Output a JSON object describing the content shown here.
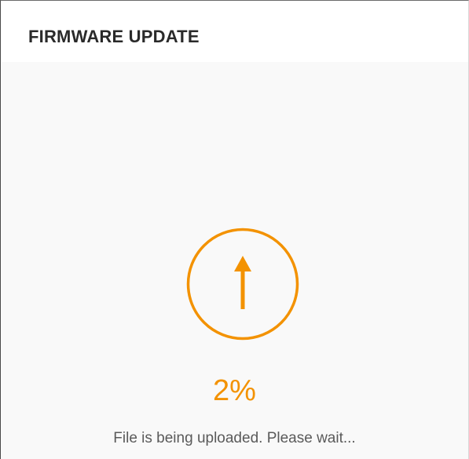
{
  "dialog": {
    "title": "FIRMWARE UPDATE"
  },
  "upload": {
    "icon": "upload-arrow-icon",
    "progress_text": "2%",
    "progress_fraction": 0.02,
    "status_text": "File is being uploaded. Please wait..."
  },
  "colors": {
    "accent": "#f39200",
    "title": "#2a2a2a",
    "status": "#5a5a5a",
    "background": "#f9f9f9",
    "header_background": "#ffffff"
  }
}
